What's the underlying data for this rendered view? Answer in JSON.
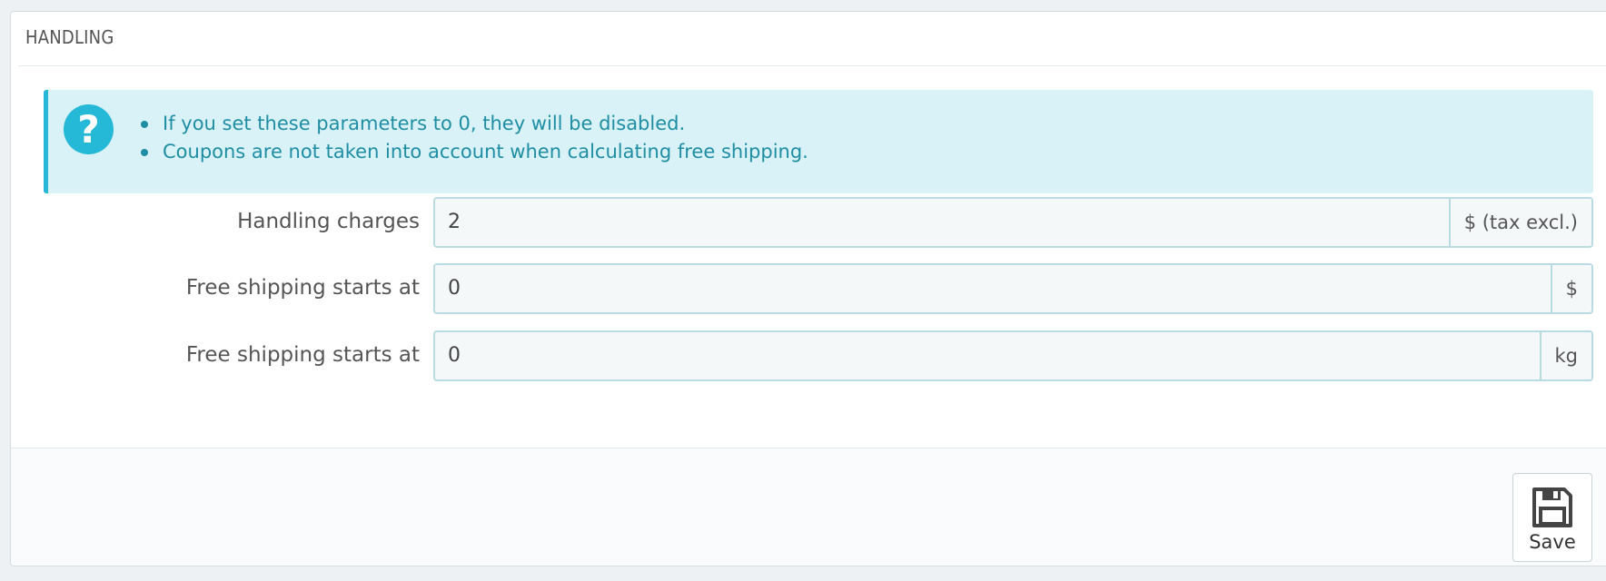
{
  "panel": {
    "title": "HANDLING"
  },
  "alert": {
    "icon": "question-circle-icon",
    "items": [
      "If you set these parameters to 0, they will be disabled.",
      "Coupons are not taken into account when calculating free shipping."
    ]
  },
  "form": {
    "handling_charges": {
      "label": "Handling charges",
      "value": "2",
      "addon": "$ (tax excl.)"
    },
    "free_shipping_price": {
      "label": "Free shipping starts at",
      "value": "0",
      "addon": "$"
    },
    "free_shipping_weight": {
      "label": "Free shipping starts at",
      "value": "0",
      "addon": "kg"
    }
  },
  "footer": {
    "save_label": "Save",
    "save_icon": "floppy-disk-icon"
  },
  "colors": {
    "accent": "#25b9d7",
    "alert_bg": "#d9f2f8",
    "alert_text": "#1f8ea3"
  }
}
